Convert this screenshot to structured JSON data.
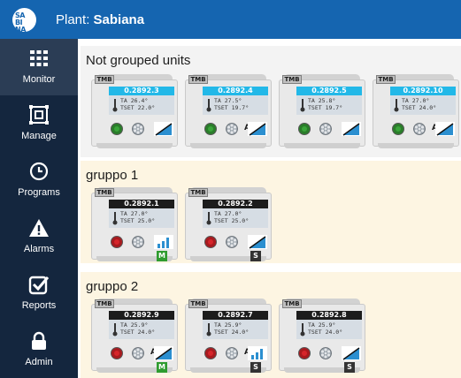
{
  "header": {
    "plant_label": "Plant:",
    "plant_name": "Sabiana",
    "logo_text": "SA BI NA"
  },
  "colors": {
    "topbar": "#1565b0",
    "sidebar": "#14263e",
    "sidebar_active": "#2b3d55",
    "group_bg": "#fdf5e2",
    "id_cyan": "#22b8e8",
    "id_black": "#1c1c1c",
    "power_green": "#3aa53a",
    "power_red": "#d6262b",
    "mode_green": "#2f9c2f",
    "mode_dark": "#333333"
  },
  "nav": [
    {
      "label": "Monitor",
      "icon": "grid-icon",
      "active": true
    },
    {
      "label": "Manage",
      "icon": "manage-icon",
      "active": false
    },
    {
      "label": "Programs",
      "icon": "clock-icon",
      "active": false
    },
    {
      "label": "Alarms",
      "icon": "warning-icon",
      "active": false
    },
    {
      "label": "Reports",
      "icon": "checkbox-icon",
      "active": false
    },
    {
      "label": "Admin",
      "icon": "lock-icon",
      "active": false
    }
  ],
  "groups": [
    {
      "title": "Not grouped units",
      "units": [
        {
          "id": "0.2892.3",
          "ta": "TA  26.4°",
          "tset": "TSET 22.0°",
          "power": "green",
          "ramp": "triangle",
          "letter": "",
          "mode": ""
        },
        {
          "id": "0.2892.4",
          "ta": "TA  27.5°",
          "tset": "TSET 19.7°",
          "power": "green",
          "ramp": "triangle",
          "letter": "A",
          "mode": ""
        },
        {
          "id": "0.2892.5",
          "ta": "TA  25.8°",
          "tset": "TSET 19.7°",
          "power": "green",
          "ramp": "triangle",
          "letter": "",
          "mode": ""
        },
        {
          "id": "0.2892.10",
          "ta": "TA  27.0°",
          "tset": "TSET 24.0°",
          "power": "green",
          "ramp": "triangle",
          "letter": "A",
          "mode": ""
        }
      ]
    },
    {
      "title": "gruppo 1",
      "units": [
        {
          "id": "0.2892.1",
          "ta": "TA  27.0°",
          "tset": "TSET 25.0°",
          "power": "red",
          "ramp": "bars",
          "letter": "",
          "mode": "M"
        },
        {
          "id": "0.2892.2",
          "ta": "TA  27.0°",
          "tset": "TSET 25.0°",
          "power": "red",
          "ramp": "triangle",
          "letter": "",
          "mode": "S"
        }
      ]
    },
    {
      "title": "gruppo 2",
      "units": [
        {
          "id": "0.2892.9",
          "ta": "TA  25.9°",
          "tset": "TSET 24.0°",
          "power": "red",
          "ramp": "triangle",
          "letter": "A",
          "mode": "M"
        },
        {
          "id": "0.2892.7",
          "ta": "TA  25.9°",
          "tset": "TSET 24.0°",
          "power": "red",
          "ramp": "bars",
          "letter": "A",
          "mode": "S"
        },
        {
          "id": "0.2892.8",
          "ta": "TA  25.9°",
          "tset": "TSET 24.0°",
          "power": "red",
          "ramp": "triangle",
          "letter": "",
          "mode": "S"
        }
      ]
    }
  ]
}
